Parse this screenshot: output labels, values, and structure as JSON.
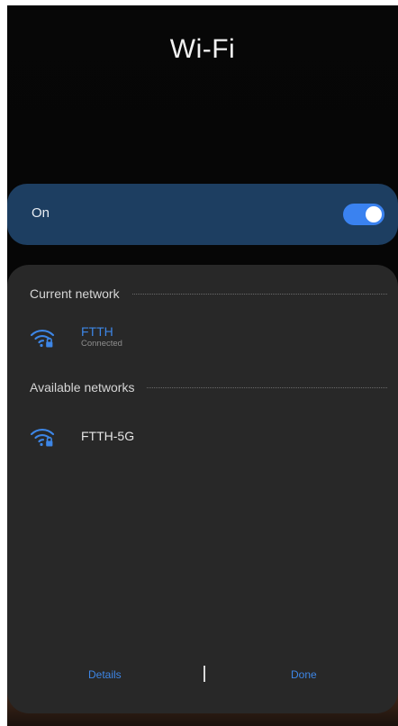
{
  "header": {
    "title": "Wi-Fi"
  },
  "wifi_toggle": {
    "label": "On",
    "state": "on",
    "accent": "#3a82f0"
  },
  "current_network": {
    "section_title": "Current network",
    "network": {
      "name": "FTTH",
      "status": "Connected",
      "icon": "wifi-lock-icon",
      "name_color": "#3d86e6"
    }
  },
  "available_networks": {
    "section_title": "Available networks",
    "networks": [
      {
        "name": "FTTH-5G",
        "icon": "wifi-lock-icon"
      }
    ]
  },
  "footer": {
    "details_label": "Details",
    "done_label": "Done"
  },
  "colors": {
    "panel": "#282828",
    "toggle_bar": "#1d3e61",
    "link": "#3d86e6"
  }
}
